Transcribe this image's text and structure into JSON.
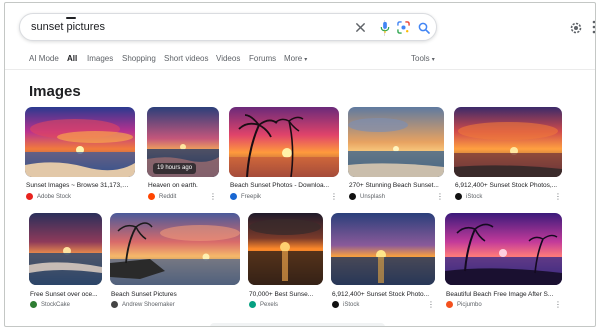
{
  "search": {
    "query": "sunset pictures"
  },
  "tabs": [
    {
      "label": "AI Mode"
    },
    {
      "label": "All"
    },
    {
      "label": "Images"
    },
    {
      "label": "Shopping"
    },
    {
      "label": "Short videos"
    },
    {
      "label": "Videos"
    },
    {
      "label": "Forums"
    },
    {
      "label": "More"
    }
  ],
  "tools_label": "Tools",
  "section_title": "Images",
  "results": [
    {
      "caption": "Sunset Images ~ Browse 31,173,1...",
      "source": "Adobe Stock",
      "badge": ""
    },
    {
      "caption": "Heaven on earth.",
      "source": "Reddit",
      "badge": "19 hours ago"
    },
    {
      "caption": "Beach Sunset Photos - Downloa...",
      "source": "Freepik",
      "badge": ""
    },
    {
      "caption": "270+ Stunning Beach Sunset...",
      "source": "Unsplash",
      "badge": ""
    },
    {
      "caption": "6,912,400+ Sunset Stock Photos,...",
      "source": "iStock",
      "badge": ""
    },
    {
      "caption": "Free Sunset over oce...",
      "source": "StockCake",
      "badge": ""
    },
    {
      "caption": "Beach Sunset Pictures",
      "source": "Andrew Shoemaker",
      "badge": ""
    },
    {
      "caption": "70,000+ Best Sunse...",
      "source": "Pexels",
      "badge": ""
    },
    {
      "caption": "6,912,400+ Sunset Stock Photo...",
      "source": "iStock",
      "badge": ""
    },
    {
      "caption": "Beautiful Beach Free Image After S...",
      "source": "Picjumbo",
      "badge": ""
    }
  ],
  "colors": {
    "text": "#202124",
    "muted": "#5f6368",
    "border": "#dadce0",
    "favicons": [
      "#e8231e",
      "#ff4500",
      "#1967d2",
      "#111111",
      "#111111",
      "#2e7d32",
      "#444444",
      "#05a081",
      "#111111",
      "#f4511e"
    ]
  },
  "icons": [
    "close-icon",
    "mic-icon",
    "lens-icon",
    "search-icon",
    "settings-icon",
    "apps-icon"
  ]
}
